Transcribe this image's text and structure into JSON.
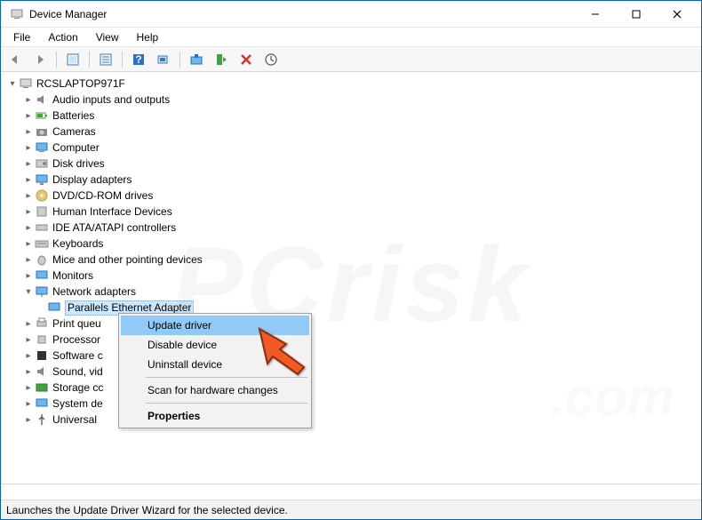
{
  "window": {
    "title": "Device Manager"
  },
  "menu": {
    "file": "File",
    "action": "Action",
    "view": "View",
    "help": "Help"
  },
  "tree": {
    "root": "RCSLAPTOP971F",
    "items": [
      "Audio inputs and outputs",
      "Batteries",
      "Cameras",
      "Computer",
      "Disk drives",
      "Display adapters",
      "DVD/CD-ROM drives",
      "Human Interface Devices",
      "IDE ATA/ATAPI controllers",
      "Keyboards",
      "Mice and other pointing devices",
      "Monitors",
      "Network adapters",
      "Print queu",
      "Processor",
      "Software c",
      "Sound, vid",
      "Storage cc",
      "System de",
      "Universal "
    ],
    "network_child": "Parallels Ethernet Adapter"
  },
  "context": {
    "update": "Update driver",
    "disable": "Disable device",
    "uninstall": "Uninstall device",
    "scan": "Scan for hardware changes",
    "properties": "Properties"
  },
  "status": "Launches the Update Driver Wizard for the selected device."
}
